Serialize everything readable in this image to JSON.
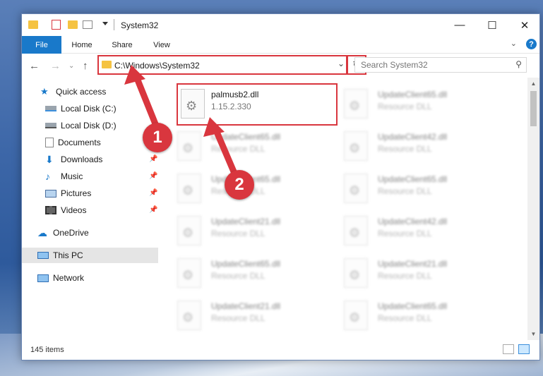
{
  "window": {
    "title": "System32",
    "minimize": "—",
    "maximize": "☐",
    "close": "✕"
  },
  "ribbon": {
    "tabs": [
      {
        "label": "File"
      },
      {
        "label": "Home"
      },
      {
        "label": "Share"
      },
      {
        "label": "View"
      }
    ],
    "expand": "⌄",
    "help": "?"
  },
  "navigation": {
    "back": "←",
    "forward": "→",
    "recent": "⌄",
    "up": "↑",
    "address_path": "C:\\Windows\\System32",
    "address_dropdown": "⌄",
    "refresh": "↻",
    "search_placeholder": "Search System32",
    "search_icon": "⚲"
  },
  "sidebar": {
    "items": [
      {
        "label": "Quick access",
        "icon": "star-icon",
        "pinned": false
      },
      {
        "label": "Local Disk (C:)",
        "icon": "drive-icon",
        "pinned": false
      },
      {
        "label": "Local Disk (D:)",
        "icon": "drive-icon",
        "pinned": false
      },
      {
        "label": "Documents",
        "icon": "documents-icon",
        "pinned": false
      },
      {
        "label": "Downloads",
        "icon": "download-icon",
        "pinned": true
      },
      {
        "label": "Music",
        "icon": "music-icon",
        "pinned": true
      },
      {
        "label": "Pictures",
        "icon": "pictures-icon",
        "pinned": true
      },
      {
        "label": "Videos",
        "icon": "videos-icon",
        "pinned": true
      },
      {
        "label": "OneDrive",
        "icon": "cloud-icon",
        "pinned": false
      },
      {
        "label": "This PC",
        "icon": "computer-icon",
        "pinned": false,
        "selected": true
      },
      {
        "label": "Network",
        "icon": "network-icon",
        "pinned": false
      }
    ],
    "pin_glyph": "📌"
  },
  "files": [
    {
      "name": "palmusb2.dll",
      "sub": "1.15.2.330",
      "highlighted": true
    },
    {
      "name": "UpdateClient65.dll",
      "sub": "Resource DLL"
    },
    {
      "name": "UpdateClient65.dll",
      "sub": "Resource DLL"
    },
    {
      "name": "UpdateClient42.dll",
      "sub": "Resource DLL"
    },
    {
      "name": "UpdateClient65.dll",
      "sub": "Resource DLL"
    },
    {
      "name": "UpdateClient65.dll",
      "sub": "Resource DLL"
    },
    {
      "name": "UpdateClient21.dll",
      "sub": "Resource DLL"
    },
    {
      "name": "UpdateClient42.dll",
      "sub": "Resource DLL"
    },
    {
      "name": "UpdateClient65.dll",
      "sub": "Resource DLL"
    },
    {
      "name": "UpdateClient21.dll",
      "sub": "Resource DLL"
    },
    {
      "name": "UpdateClient21.dll",
      "sub": "Resource DLL"
    },
    {
      "name": "UpdateClient65.dll",
      "sub": "Resource DLL"
    }
  ],
  "status": {
    "item_count": "145 items"
  },
  "annotations": {
    "step1": "1",
    "step2": "2",
    "color": "#d9363e"
  }
}
